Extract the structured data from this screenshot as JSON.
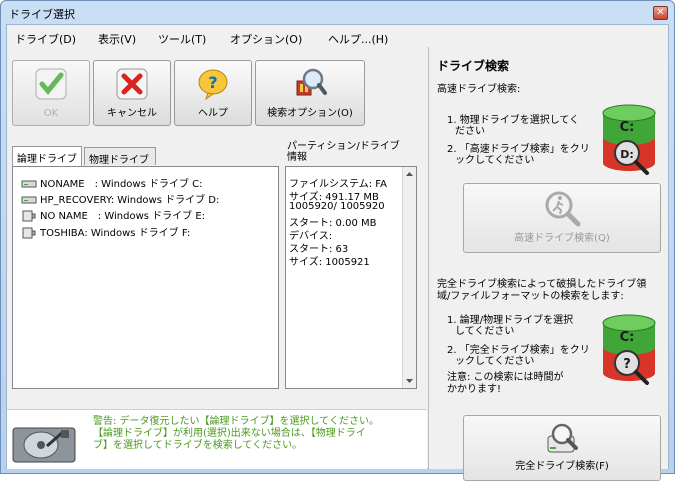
{
  "window": {
    "title": "ドライブ選択",
    "close": "✕"
  },
  "menu": [
    "ドライブ(D)",
    "表示(V)",
    "ツール(T)",
    "オプション(O)",
    "ヘルプ...(H)"
  ],
  "toolbar": {
    "ok": "OK",
    "cancel": "キャンセル",
    "help": "ヘルプ",
    "search_options": "検索オプション(O)"
  },
  "tabs": {
    "logical": "論理ドライブ",
    "physical": "物理ドライブ"
  },
  "drives": [
    {
      "label": "NONAME　: Windows ドライブ C:"
    },
    {
      "label": "HP_RECOVERY: Windows ドライブ D:"
    },
    {
      "label": "NO NAME　: Windows ドライブ E:"
    },
    {
      "label": "TOSHIBA: Windows ドライブ F:"
    }
  ],
  "partition": {
    "header": "パーティション/ドライブ 情報",
    "lines": [
      "ファイルシステム: FA",
      "サイズ: 491.17 MB",
      "1005920/ 1005920",
      "スタート: 0.00 MB",
      "デバイス:",
      "スタート:  63",
      "サイズ: 1005921"
    ]
  },
  "warning": {
    "line1": "警告: データ復元したい【論理ドライブ】を選択してください。",
    "line2": "【論理ドライブ】が利用(選択)出来ない場合は、【物理ドライ",
    "line3": "ブ】を選択してドライブを検索してください。"
  },
  "right": {
    "heading": "ドライブ検索",
    "quick_title": "高速ドライブ検索:",
    "quick_step1": "1. 物理ドライブを選択してく",
    "quick_step1b": "ださい",
    "quick_step2": "2. 「高速ドライブ検索」をクリ",
    "quick_step2b": "ックしてください",
    "quick_button": "高速ドライブ検索(Q)",
    "full_desc1": "完全ドライブ検索によって破損したドライブ領",
    "full_desc2": "域/ファイルフォーマットの検索をします:",
    "full_step1": "1. 論理/物理ドライブを選択",
    "full_step1b": "してください",
    "full_step2": "2. 「完全ドライブ検索」をクリ",
    "full_step2b": "ックしてください",
    "note1": "注意: この検索には時間が",
    "note2": "かかります!",
    "full_button": "完全ドライブ検索(F)",
    "disk_c": "C:",
    "disk_d": "D:",
    "disk_q": "?"
  }
}
